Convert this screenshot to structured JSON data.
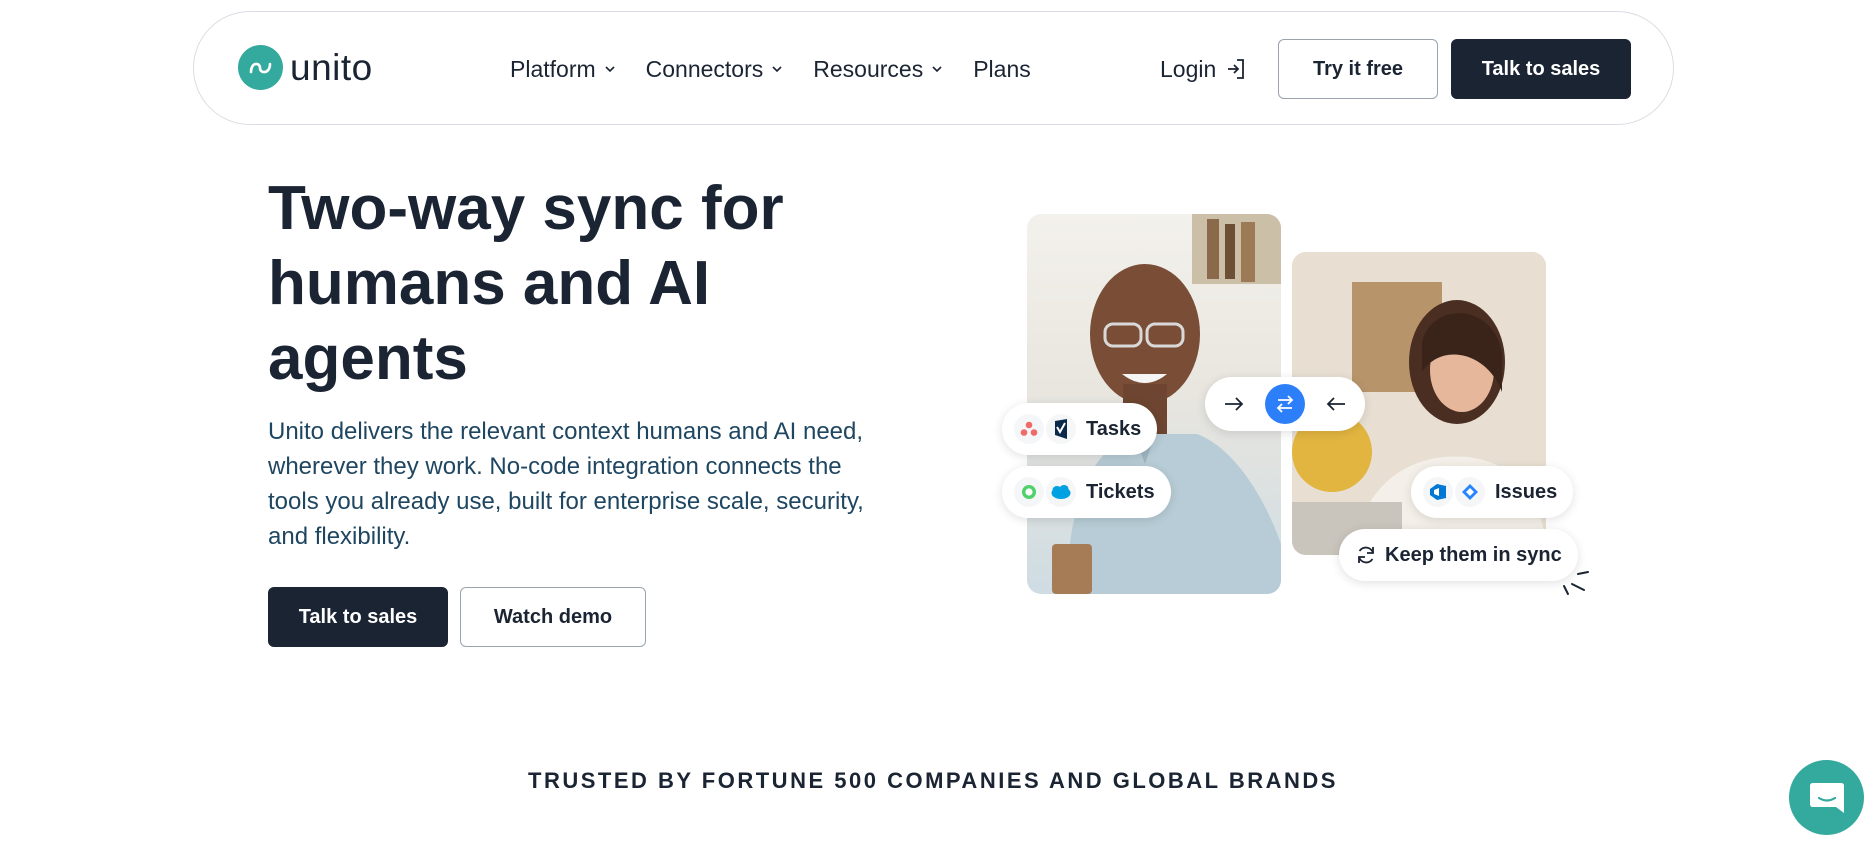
{
  "brand": {
    "name": "unito",
    "accent_color": "#34a99d",
    "dark_color": "#1b2433"
  },
  "nav": {
    "items": [
      {
        "label": "Platform",
        "has_dropdown": true
      },
      {
        "label": "Connectors",
        "has_dropdown": true
      },
      {
        "label": "Resources",
        "has_dropdown": true
      },
      {
        "label": "Plans",
        "has_dropdown": false
      }
    ],
    "login_label": "Login",
    "try_label": "Try it free",
    "sales_label": "Talk to sales"
  },
  "hero": {
    "title": "Two-way sync for humans and AI agents",
    "description": "Unito delivers the relevant context humans and AI need, wherever they work. No-code integration connects the tools you already use, built for enterprise scale, security, and flexibility.",
    "primary_cta": "Talk to sales",
    "secondary_cta": "Watch demo"
  },
  "illustration": {
    "pills": {
      "tasks": "Tasks",
      "tickets": "Tickets",
      "issues": "Issues",
      "sync": "Keep them in sync"
    },
    "icons": [
      "asana-icon",
      "smartsheet-icon",
      "zendesk-icon",
      "salesforce-icon",
      "azure-devops-icon",
      "jira-icon",
      "refresh-icon",
      "swap-arrows-icon"
    ]
  },
  "trusted": {
    "heading": "TRUSTED BY FORTUNE 500 COMPANIES AND GLOBAL BRANDS"
  },
  "chat": {
    "icon": "chat-icon"
  }
}
